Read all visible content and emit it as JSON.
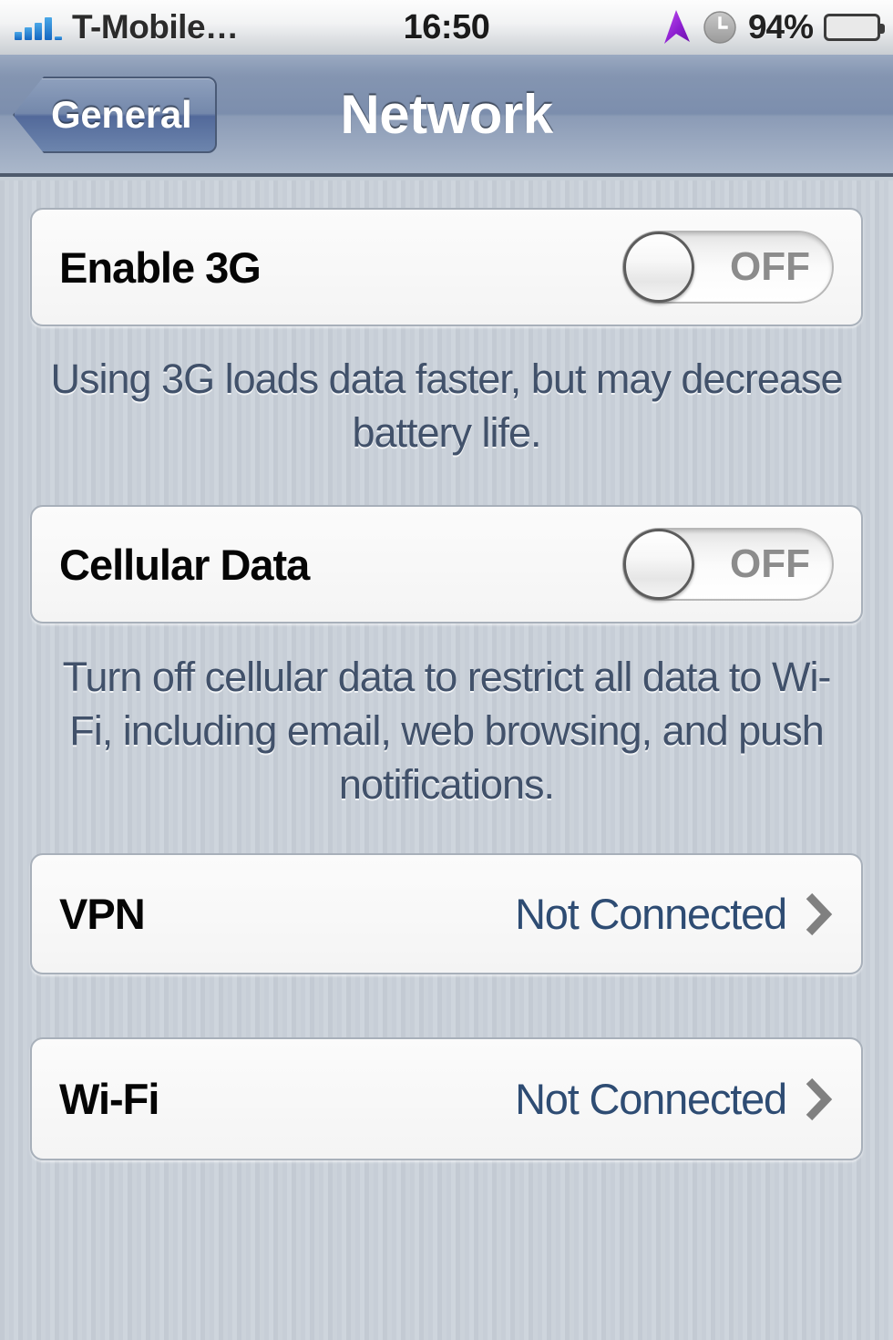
{
  "status_bar": {
    "carrier": "T-Mobile…",
    "time": "16:50",
    "battery_percent": "94%",
    "signal_icon": "signal-bars-icon",
    "location_icon": "location-arrow-icon",
    "alarm_icon": "alarm-clock-icon",
    "battery_icon": "battery-icon"
  },
  "nav_bar": {
    "back_label": "General",
    "title": "Network"
  },
  "sections": {
    "enable_3g": {
      "label": "Enable 3G",
      "switch_state": "OFF",
      "footer": "Using 3G loads data faster, but may decrease battery life."
    },
    "cellular_data": {
      "label": "Cellular Data",
      "switch_state": "OFF",
      "footer": "Turn off cellular data to restrict all data to Wi-Fi, including email, web browsing, and push notifications."
    },
    "vpn": {
      "label": "VPN",
      "value": "Not Connected",
      "disclosure_icon": "chevron-right-icon"
    },
    "wifi": {
      "label": "Wi-Fi",
      "value": "Not Connected",
      "disclosure_icon": "chevron-right-icon"
    }
  },
  "colors": {
    "nav_bar": "#7c8ead",
    "value_text": "#2e4c73",
    "footer_text": "#41516a",
    "switch_off_text": "#8c8c8c",
    "battery_green": "#79cc3c",
    "signal_blue": "#1566c0",
    "location_purple": "#9b2fd6"
  }
}
